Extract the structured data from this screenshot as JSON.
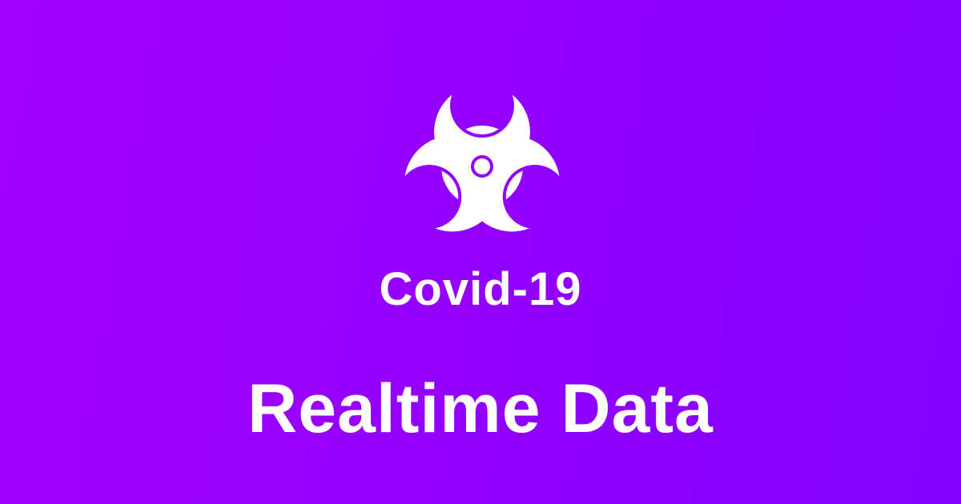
{
  "logo": {
    "icon": "biohazard-icon",
    "color": "#ffffff"
  },
  "title": "Covid-19",
  "subtitle": "Realtime Data",
  "colors": {
    "background_start": "#a400ff",
    "background_end": "#8200ff",
    "text": "#ffffff"
  }
}
